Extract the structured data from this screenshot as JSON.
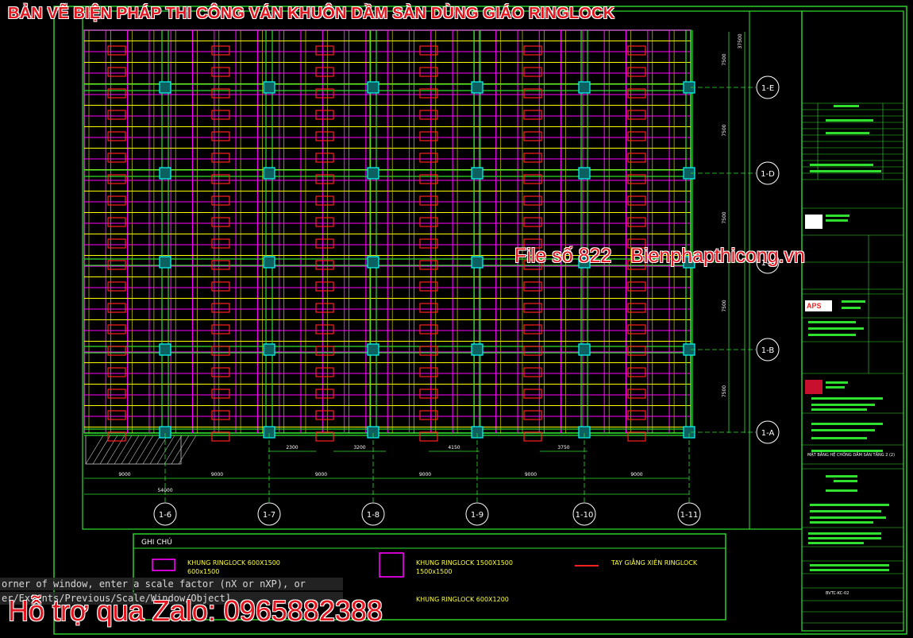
{
  "banner_title": "BẢN VẼ BIỆN PHÁP THI CÔNG VÁN KHUÔN DẦM SÀN DÙNG GIÁO RINGLOCK",
  "watermark": {
    "file_no": "File số 822",
    "site": "Bienphapthicong.vn"
  },
  "support_line": "Hỗ trợ qua Zalo: 0965882388",
  "command_lines": [
    "orner of window, enter a scale factor (nX or nXP), or",
    "er/Extents/Previous/Scale/Window/Object]"
  ],
  "column_grid_labels": [
    "1-6",
    "1-7",
    "1-8",
    "1-9",
    "1-10",
    "1-11"
  ],
  "row_grid_labels": [
    "1-E",
    "1-D",
    "1-C",
    "1-B",
    "1-A"
  ],
  "dims_bottom_spans": [
    "9000",
    "9000",
    "9000",
    "9000",
    "9000",
    "9000"
  ],
  "dims_bottom_total": "54000",
  "dims_bottom_partial": [
    "2300",
    "3200",
    "4150",
    "3750"
  ],
  "dims_right_spans": [
    "7500",
    "7500",
    "7500",
    "7500",
    "7500"
  ],
  "dims_right_total": "37500",
  "legend": {
    "header": "GHI CHÚ",
    "items": [
      {
        "label": "KHUNG RINGLOCK 600X1500",
        "sub": "600x1500"
      },
      {
        "label": "KHUNG RINGLOCK 1500X1500",
        "sub": "1500x1500"
      },
      {
        "label": "TAY GIẰNG XIÊN RINGLOCK",
        "sub": ""
      },
      {
        "label": "KHUNG RINGLOCK 600X1200",
        "sub": ""
      }
    ]
  },
  "title_block": {
    "logo": "APS",
    "drawing_name": "MẶT BẰNG HỆ CHỐNG DẦM SÀN TẦNG 2 (2)",
    "drawing_no": "BVTC-KC-02"
  },
  "colors": {
    "frame": "#2fe02f",
    "magenta": "#ff00ff",
    "yellow": "#ffff00",
    "red": "#ff2020",
    "cyan": "#00ffff",
    "banner_red": "#e3161f"
  }
}
